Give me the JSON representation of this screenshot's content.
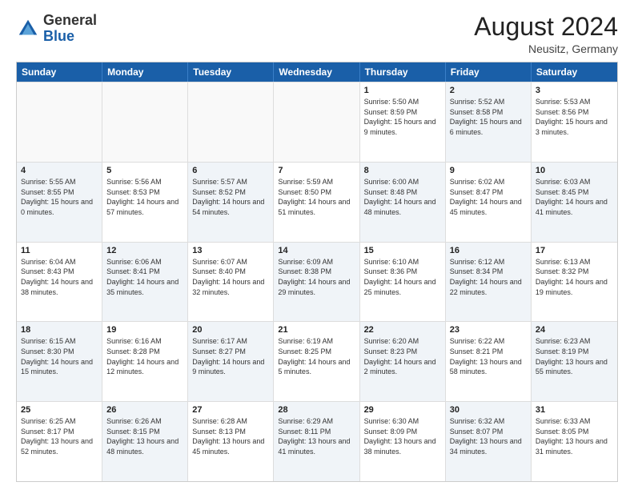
{
  "header": {
    "logo": {
      "general": "General",
      "blue": "Blue"
    },
    "title": "August 2024",
    "location": "Neusitz, Germany"
  },
  "calendar": {
    "days_of_week": [
      "Sunday",
      "Monday",
      "Tuesday",
      "Wednesday",
      "Thursday",
      "Friday",
      "Saturday"
    ],
    "weeks": [
      [
        {
          "day": "",
          "info": "",
          "shaded": false,
          "empty": true
        },
        {
          "day": "",
          "info": "",
          "shaded": false,
          "empty": true
        },
        {
          "day": "",
          "info": "",
          "shaded": false,
          "empty": true
        },
        {
          "day": "",
          "info": "",
          "shaded": false,
          "empty": true
        },
        {
          "day": "1",
          "info": "Sunrise: 5:50 AM\nSunset: 8:59 PM\nDaylight: 15 hours and 9 minutes.",
          "shaded": false
        },
        {
          "day": "2",
          "info": "Sunrise: 5:52 AM\nSunset: 8:58 PM\nDaylight: 15 hours and 6 minutes.",
          "shaded": true
        },
        {
          "day": "3",
          "info": "Sunrise: 5:53 AM\nSunset: 8:56 PM\nDaylight: 15 hours and 3 minutes.",
          "shaded": false
        }
      ],
      [
        {
          "day": "4",
          "info": "Sunrise: 5:55 AM\nSunset: 8:55 PM\nDaylight: 15 hours and 0 minutes.",
          "shaded": true
        },
        {
          "day": "5",
          "info": "Sunrise: 5:56 AM\nSunset: 8:53 PM\nDaylight: 14 hours and 57 minutes.",
          "shaded": false
        },
        {
          "day": "6",
          "info": "Sunrise: 5:57 AM\nSunset: 8:52 PM\nDaylight: 14 hours and 54 minutes.",
          "shaded": true
        },
        {
          "day": "7",
          "info": "Sunrise: 5:59 AM\nSunset: 8:50 PM\nDaylight: 14 hours and 51 minutes.",
          "shaded": false
        },
        {
          "day": "8",
          "info": "Sunrise: 6:00 AM\nSunset: 8:48 PM\nDaylight: 14 hours and 48 minutes.",
          "shaded": true
        },
        {
          "day": "9",
          "info": "Sunrise: 6:02 AM\nSunset: 8:47 PM\nDaylight: 14 hours and 45 minutes.",
          "shaded": false
        },
        {
          "day": "10",
          "info": "Sunrise: 6:03 AM\nSunset: 8:45 PM\nDaylight: 14 hours and 41 minutes.",
          "shaded": true
        }
      ],
      [
        {
          "day": "11",
          "info": "Sunrise: 6:04 AM\nSunset: 8:43 PM\nDaylight: 14 hours and 38 minutes.",
          "shaded": false
        },
        {
          "day": "12",
          "info": "Sunrise: 6:06 AM\nSunset: 8:41 PM\nDaylight: 14 hours and 35 minutes.",
          "shaded": true
        },
        {
          "day": "13",
          "info": "Sunrise: 6:07 AM\nSunset: 8:40 PM\nDaylight: 14 hours and 32 minutes.",
          "shaded": false
        },
        {
          "day": "14",
          "info": "Sunrise: 6:09 AM\nSunset: 8:38 PM\nDaylight: 14 hours and 29 minutes.",
          "shaded": true
        },
        {
          "day": "15",
          "info": "Sunrise: 6:10 AM\nSunset: 8:36 PM\nDaylight: 14 hours and 25 minutes.",
          "shaded": false
        },
        {
          "day": "16",
          "info": "Sunrise: 6:12 AM\nSunset: 8:34 PM\nDaylight: 14 hours and 22 minutes.",
          "shaded": true
        },
        {
          "day": "17",
          "info": "Sunrise: 6:13 AM\nSunset: 8:32 PM\nDaylight: 14 hours and 19 minutes.",
          "shaded": false
        }
      ],
      [
        {
          "day": "18",
          "info": "Sunrise: 6:15 AM\nSunset: 8:30 PM\nDaylight: 14 hours and 15 minutes.",
          "shaded": true
        },
        {
          "day": "19",
          "info": "Sunrise: 6:16 AM\nSunset: 8:28 PM\nDaylight: 14 hours and 12 minutes.",
          "shaded": false
        },
        {
          "day": "20",
          "info": "Sunrise: 6:17 AM\nSunset: 8:27 PM\nDaylight: 14 hours and 9 minutes.",
          "shaded": true
        },
        {
          "day": "21",
          "info": "Sunrise: 6:19 AM\nSunset: 8:25 PM\nDaylight: 14 hours and 5 minutes.",
          "shaded": false
        },
        {
          "day": "22",
          "info": "Sunrise: 6:20 AM\nSunset: 8:23 PM\nDaylight: 14 hours and 2 minutes.",
          "shaded": true
        },
        {
          "day": "23",
          "info": "Sunrise: 6:22 AM\nSunset: 8:21 PM\nDaylight: 13 hours and 58 minutes.",
          "shaded": false
        },
        {
          "day": "24",
          "info": "Sunrise: 6:23 AM\nSunset: 8:19 PM\nDaylight: 13 hours and 55 minutes.",
          "shaded": true
        }
      ],
      [
        {
          "day": "25",
          "info": "Sunrise: 6:25 AM\nSunset: 8:17 PM\nDaylight: 13 hours and 52 minutes.",
          "shaded": false
        },
        {
          "day": "26",
          "info": "Sunrise: 6:26 AM\nSunset: 8:15 PM\nDaylight: 13 hours and 48 minutes.",
          "shaded": true
        },
        {
          "day": "27",
          "info": "Sunrise: 6:28 AM\nSunset: 8:13 PM\nDaylight: 13 hours and 45 minutes.",
          "shaded": false
        },
        {
          "day": "28",
          "info": "Sunrise: 6:29 AM\nSunset: 8:11 PM\nDaylight: 13 hours and 41 minutes.",
          "shaded": true
        },
        {
          "day": "29",
          "info": "Sunrise: 6:30 AM\nSunset: 8:09 PM\nDaylight: 13 hours and 38 minutes.",
          "shaded": false
        },
        {
          "day": "30",
          "info": "Sunrise: 6:32 AM\nSunset: 8:07 PM\nDaylight: 13 hours and 34 minutes.",
          "shaded": true
        },
        {
          "day": "31",
          "info": "Sunrise: 6:33 AM\nSunset: 8:05 PM\nDaylight: 13 hours and 31 minutes.",
          "shaded": false
        }
      ]
    ]
  }
}
